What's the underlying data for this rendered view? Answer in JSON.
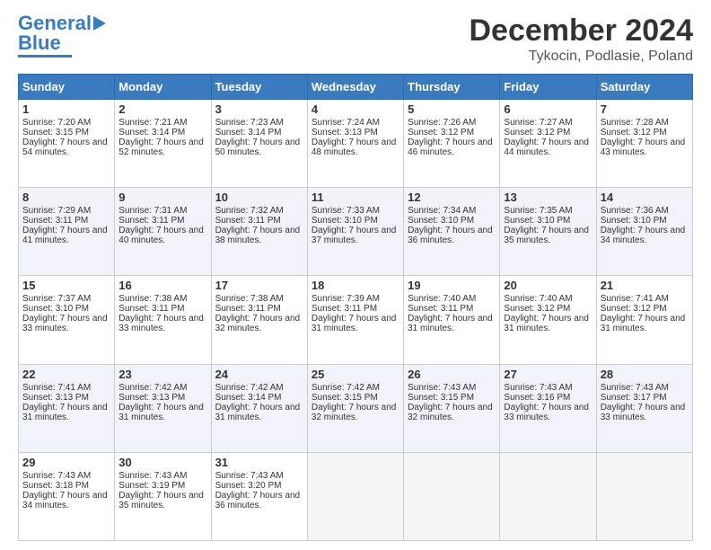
{
  "logo": {
    "line1": "General",
    "line2": "Blue"
  },
  "title": "December 2024",
  "subtitle": "Tykocin, Podlasie, Poland",
  "days_of_week": [
    "Sunday",
    "Monday",
    "Tuesday",
    "Wednesday",
    "Thursday",
    "Friday",
    "Saturday"
  ],
  "weeks": [
    [
      {
        "day": "1",
        "sunrise": "Sunrise: 7:20 AM",
        "sunset": "Sunset: 3:15 PM",
        "daylight": "Daylight: 7 hours and 54 minutes."
      },
      {
        "day": "2",
        "sunrise": "Sunrise: 7:21 AM",
        "sunset": "Sunset: 3:14 PM",
        "daylight": "Daylight: 7 hours and 52 minutes."
      },
      {
        "day": "3",
        "sunrise": "Sunrise: 7:23 AM",
        "sunset": "Sunset: 3:14 PM",
        "daylight": "Daylight: 7 hours and 50 minutes."
      },
      {
        "day": "4",
        "sunrise": "Sunrise: 7:24 AM",
        "sunset": "Sunset: 3:13 PM",
        "daylight": "Daylight: 7 hours and 48 minutes."
      },
      {
        "day": "5",
        "sunrise": "Sunrise: 7:26 AM",
        "sunset": "Sunset: 3:12 PM",
        "daylight": "Daylight: 7 hours and 46 minutes."
      },
      {
        "day": "6",
        "sunrise": "Sunrise: 7:27 AM",
        "sunset": "Sunset: 3:12 PM",
        "daylight": "Daylight: 7 hours and 44 minutes."
      },
      {
        "day": "7",
        "sunrise": "Sunrise: 7:28 AM",
        "sunset": "Sunset: 3:12 PM",
        "daylight": "Daylight: 7 hours and 43 minutes."
      }
    ],
    [
      {
        "day": "8",
        "sunrise": "Sunrise: 7:29 AM",
        "sunset": "Sunset: 3:11 PM",
        "daylight": "Daylight: 7 hours and 41 minutes."
      },
      {
        "day": "9",
        "sunrise": "Sunrise: 7:31 AM",
        "sunset": "Sunset: 3:11 PM",
        "daylight": "Daylight: 7 hours and 40 minutes."
      },
      {
        "day": "10",
        "sunrise": "Sunrise: 7:32 AM",
        "sunset": "Sunset: 3:11 PM",
        "daylight": "Daylight: 7 hours and 38 minutes."
      },
      {
        "day": "11",
        "sunrise": "Sunrise: 7:33 AM",
        "sunset": "Sunset: 3:10 PM",
        "daylight": "Daylight: 7 hours and 37 minutes."
      },
      {
        "day": "12",
        "sunrise": "Sunrise: 7:34 AM",
        "sunset": "Sunset: 3:10 PM",
        "daylight": "Daylight: 7 hours and 36 minutes."
      },
      {
        "day": "13",
        "sunrise": "Sunrise: 7:35 AM",
        "sunset": "Sunset: 3:10 PM",
        "daylight": "Daylight: 7 hours and 35 minutes."
      },
      {
        "day": "14",
        "sunrise": "Sunrise: 7:36 AM",
        "sunset": "Sunset: 3:10 PM",
        "daylight": "Daylight: 7 hours and 34 minutes."
      }
    ],
    [
      {
        "day": "15",
        "sunrise": "Sunrise: 7:37 AM",
        "sunset": "Sunset: 3:10 PM",
        "daylight": "Daylight: 7 hours and 33 minutes."
      },
      {
        "day": "16",
        "sunrise": "Sunrise: 7:38 AM",
        "sunset": "Sunset: 3:11 PM",
        "daylight": "Daylight: 7 hours and 33 minutes."
      },
      {
        "day": "17",
        "sunrise": "Sunrise: 7:38 AM",
        "sunset": "Sunset: 3:11 PM",
        "daylight": "Daylight: 7 hours and 32 minutes."
      },
      {
        "day": "18",
        "sunrise": "Sunrise: 7:39 AM",
        "sunset": "Sunset: 3:11 PM",
        "daylight": "Daylight: 7 hours and 31 minutes."
      },
      {
        "day": "19",
        "sunrise": "Sunrise: 7:40 AM",
        "sunset": "Sunset: 3:11 PM",
        "daylight": "Daylight: 7 hours and 31 minutes."
      },
      {
        "day": "20",
        "sunrise": "Sunrise: 7:40 AM",
        "sunset": "Sunset: 3:12 PM",
        "daylight": "Daylight: 7 hours and 31 minutes."
      },
      {
        "day": "21",
        "sunrise": "Sunrise: 7:41 AM",
        "sunset": "Sunset: 3:12 PM",
        "daylight": "Daylight: 7 hours and 31 minutes."
      }
    ],
    [
      {
        "day": "22",
        "sunrise": "Sunrise: 7:41 AM",
        "sunset": "Sunset: 3:13 PM",
        "daylight": "Daylight: 7 hours and 31 minutes."
      },
      {
        "day": "23",
        "sunrise": "Sunrise: 7:42 AM",
        "sunset": "Sunset: 3:13 PM",
        "daylight": "Daylight: 7 hours and 31 minutes."
      },
      {
        "day": "24",
        "sunrise": "Sunrise: 7:42 AM",
        "sunset": "Sunset: 3:14 PM",
        "daylight": "Daylight: 7 hours and 31 minutes."
      },
      {
        "day": "25",
        "sunrise": "Sunrise: 7:42 AM",
        "sunset": "Sunset: 3:15 PM",
        "daylight": "Daylight: 7 hours and 32 minutes."
      },
      {
        "day": "26",
        "sunrise": "Sunrise: 7:43 AM",
        "sunset": "Sunset: 3:15 PM",
        "daylight": "Daylight: 7 hours and 32 minutes."
      },
      {
        "day": "27",
        "sunrise": "Sunrise: 7:43 AM",
        "sunset": "Sunset: 3:16 PM",
        "daylight": "Daylight: 7 hours and 33 minutes."
      },
      {
        "day": "28",
        "sunrise": "Sunrise: 7:43 AM",
        "sunset": "Sunset: 3:17 PM",
        "daylight": "Daylight: 7 hours and 33 minutes."
      }
    ],
    [
      {
        "day": "29",
        "sunrise": "Sunrise: 7:43 AM",
        "sunset": "Sunset: 3:18 PM",
        "daylight": "Daylight: 7 hours and 34 minutes."
      },
      {
        "day": "30",
        "sunrise": "Sunrise: 7:43 AM",
        "sunset": "Sunset: 3:19 PM",
        "daylight": "Daylight: 7 hours and 35 minutes."
      },
      {
        "day": "31",
        "sunrise": "Sunrise: 7:43 AM",
        "sunset": "Sunset: 3:20 PM",
        "daylight": "Daylight: 7 hours and 36 minutes."
      },
      null,
      null,
      null,
      null
    ]
  ]
}
